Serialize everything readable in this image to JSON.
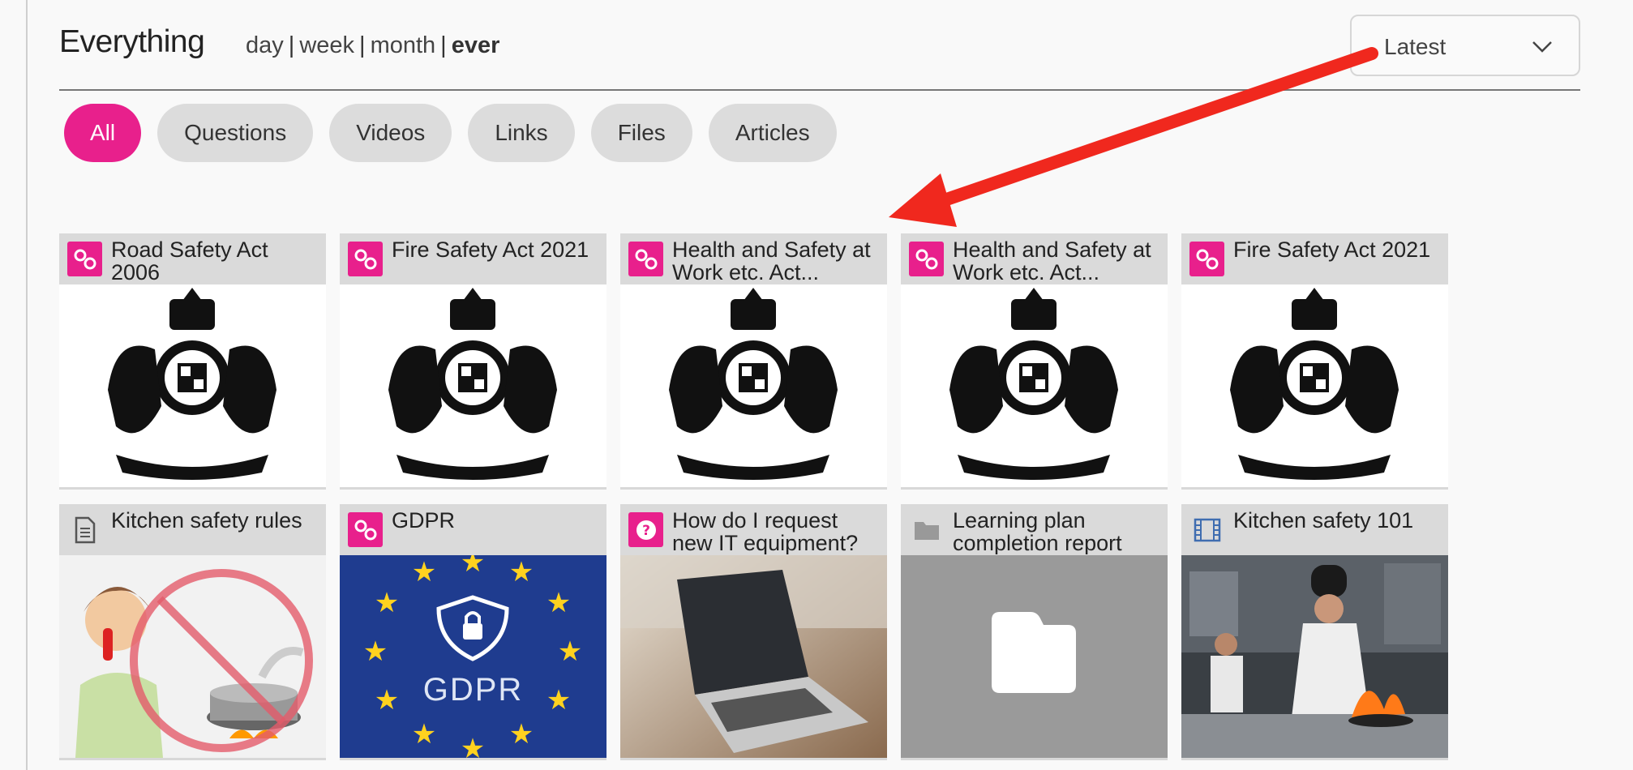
{
  "header": {
    "title": "Everything",
    "periods": [
      {
        "label": "day",
        "active": false
      },
      {
        "label": "week",
        "active": false
      },
      {
        "label": "month",
        "active": false
      },
      {
        "label": "ever",
        "active": true
      }
    ],
    "sort": {
      "selected": "Latest",
      "icon": "chevron-down-icon"
    }
  },
  "filters": [
    {
      "label": "All",
      "active": true
    },
    {
      "label": "Questions",
      "active": false
    },
    {
      "label": "Videos",
      "active": false
    },
    {
      "label": "Links",
      "active": false
    },
    {
      "label": "Files",
      "active": false
    },
    {
      "label": "Articles",
      "active": false
    }
  ],
  "colors": {
    "accent": "#e8208c",
    "pill": "#dcdcdc",
    "card_header": "#dadada",
    "annotation_arrow": "#f0281e"
  },
  "cards": [
    {
      "type": "link",
      "icon": "link-icon",
      "title": "Road Safety Act 2006",
      "media": "royal-coat-of-arms"
    },
    {
      "type": "link",
      "icon": "link-icon",
      "title": "Fire Safety Act 2021",
      "media": "royal-coat-of-arms"
    },
    {
      "type": "link",
      "icon": "link-icon",
      "title": "Health and Safety at Work etc. Act...",
      "media": "royal-coat-of-arms"
    },
    {
      "type": "link",
      "icon": "link-icon",
      "title": "Health and Safety at Work etc. Act...",
      "media": "royal-coat-of-arms"
    },
    {
      "type": "link",
      "icon": "link-icon",
      "title": "Fire Safety Act 2021",
      "media": "royal-coat-of-arms"
    },
    {
      "type": "article",
      "icon": "document-icon",
      "title": "Kitchen safety rules",
      "media": "no-phone-while-cooking-illustration"
    },
    {
      "type": "link",
      "icon": "link-icon",
      "title": "GDPR",
      "media": "gdpr-eu-stars",
      "media_text": "GDPR"
    },
    {
      "type": "question",
      "icon": "question-icon",
      "title": "How do I request new IT equipment?",
      "media": "laptop-photo"
    },
    {
      "type": "file",
      "icon": "folder-icon",
      "title": "Learning plan completion report",
      "media": "folder-placeholder"
    },
    {
      "type": "video",
      "icon": "film-icon",
      "title": "Kitchen safety 101",
      "media": "chefs-kitchen-photo"
    }
  ]
}
